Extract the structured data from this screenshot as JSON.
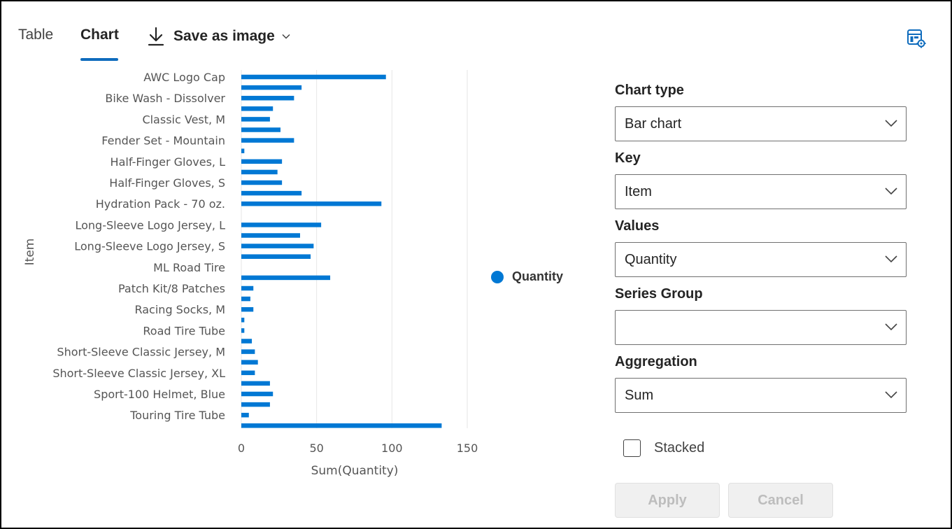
{
  "tabs": [
    {
      "label": "Table",
      "active": false
    },
    {
      "label": "Chart",
      "active": true
    }
  ],
  "toolbar": {
    "save_label": "Save as image",
    "download_icon": "download-icon",
    "chevron_icon": "chevron-down-icon",
    "settings_icon": "chart-settings-icon"
  },
  "colors": {
    "accent": "#0f6cbd",
    "bar": "#0078d4",
    "gridline": "#e6e6e6"
  },
  "chart_data": {
    "type": "bar",
    "orientation": "horizontal",
    "ylabel": "Item",
    "xlabel": "Sum(Quantity)",
    "xticks": [
      0,
      50,
      100,
      150
    ],
    "xlim": [
      0,
      150
    ],
    "grid": true,
    "legend_position": "right",
    "category_labels": [
      "AWC Logo Cap",
      "Bike Wash - Dissolver",
      "Classic Vest, M",
      "Fender Set - Mountain",
      "Half-Finger Gloves, L",
      "Half-Finger Gloves, S",
      "Hydration Pack - 70 oz.",
      "Long-Sleeve Logo Jersey, L",
      "Long-Sleeve Logo Jersey, S",
      "ML Road Tire",
      "Patch Kit/8 Patches",
      "Racing Socks, M",
      "Road Tire Tube",
      "Short-Sleeve Classic Jersey, M",
      "Short-Sleeve Classic Jersey, XL",
      "Sport-100 Helmet, Blue",
      "Touring Tire Tube"
    ],
    "series": [
      {
        "name": "Quantity",
        "values": [
          96,
          40,
          35,
          21,
          19,
          26,
          35,
          2,
          27,
          24,
          27,
          40,
          93,
          0,
          53,
          39,
          48,
          46,
          0,
          59,
          8,
          6,
          8,
          2,
          2,
          7,
          9,
          11,
          9,
          19,
          21,
          19,
          5,
          133
        ]
      }
    ]
  },
  "panel": {
    "chart_type_label": "Chart type",
    "chart_type_value": "Bar chart",
    "key_label": "Key",
    "key_value": "Item",
    "values_label": "Values",
    "values_value": "Quantity",
    "series_group_label": "Series Group",
    "series_group_value": "",
    "aggregation_label": "Aggregation",
    "aggregation_value": "Sum",
    "stacked_label": "Stacked",
    "stacked_checked": false,
    "apply_label": "Apply",
    "cancel_label": "Cancel"
  }
}
